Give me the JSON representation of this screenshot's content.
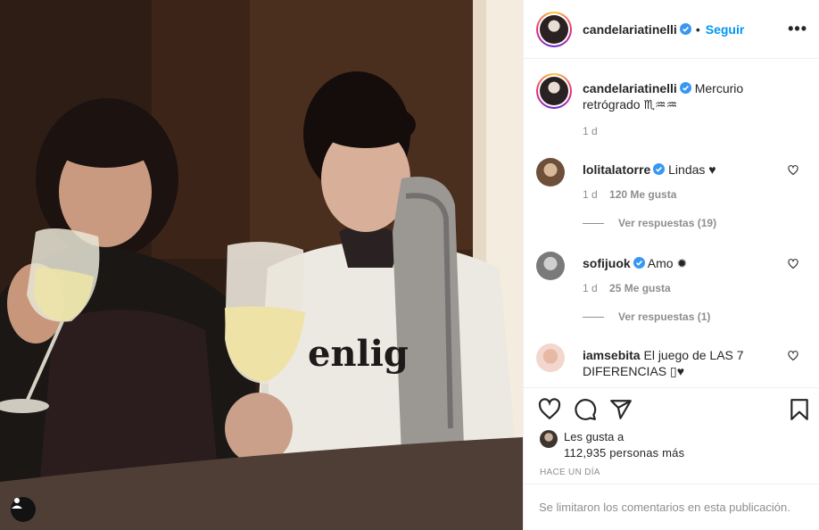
{
  "post": {
    "author": "candelariatinelli",
    "follow_label": "Seguir",
    "separator": "•",
    "more_label": "•••"
  },
  "caption": {
    "username": "candelariatinelli",
    "text": "Mercurio retrógrado ♏♒♒",
    "time": "1 d"
  },
  "comments": [
    {
      "username": "lolitalatorre",
      "text": "Lindas ♥",
      "time": "1 d",
      "likes": "120 Me gusta",
      "replies": "Ver respuestas (19)"
    },
    {
      "username": "sofijuok",
      "text": "Amo ✹",
      "time": "1 d",
      "likes": "25 Me gusta",
      "replies": "Ver respuestas (1)"
    },
    {
      "username": "iamsebita",
      "text": "El juego de LAS 7 DIFERENCIAS ▯♥"
    }
  ],
  "likes": {
    "line1": "Les gusta a",
    "line2": "112,935 personas más"
  },
  "time_ago": "HACE UN DÍA",
  "comments_limited": "Se limitaron los comentarios en esta publicación.",
  "photo": {
    "shirt_text": "enlig"
  },
  "icons": [
    "user-tag-icon",
    "verified-badge-icon",
    "heart-icon",
    "comment-icon",
    "share-icon",
    "bookmark-icon",
    "more-options-icon"
  ],
  "colors": {
    "accent": "#0095f6",
    "verified": "#3897f0",
    "text": "#262626",
    "muted": "#8e8e8e",
    "border": "#efefef"
  }
}
